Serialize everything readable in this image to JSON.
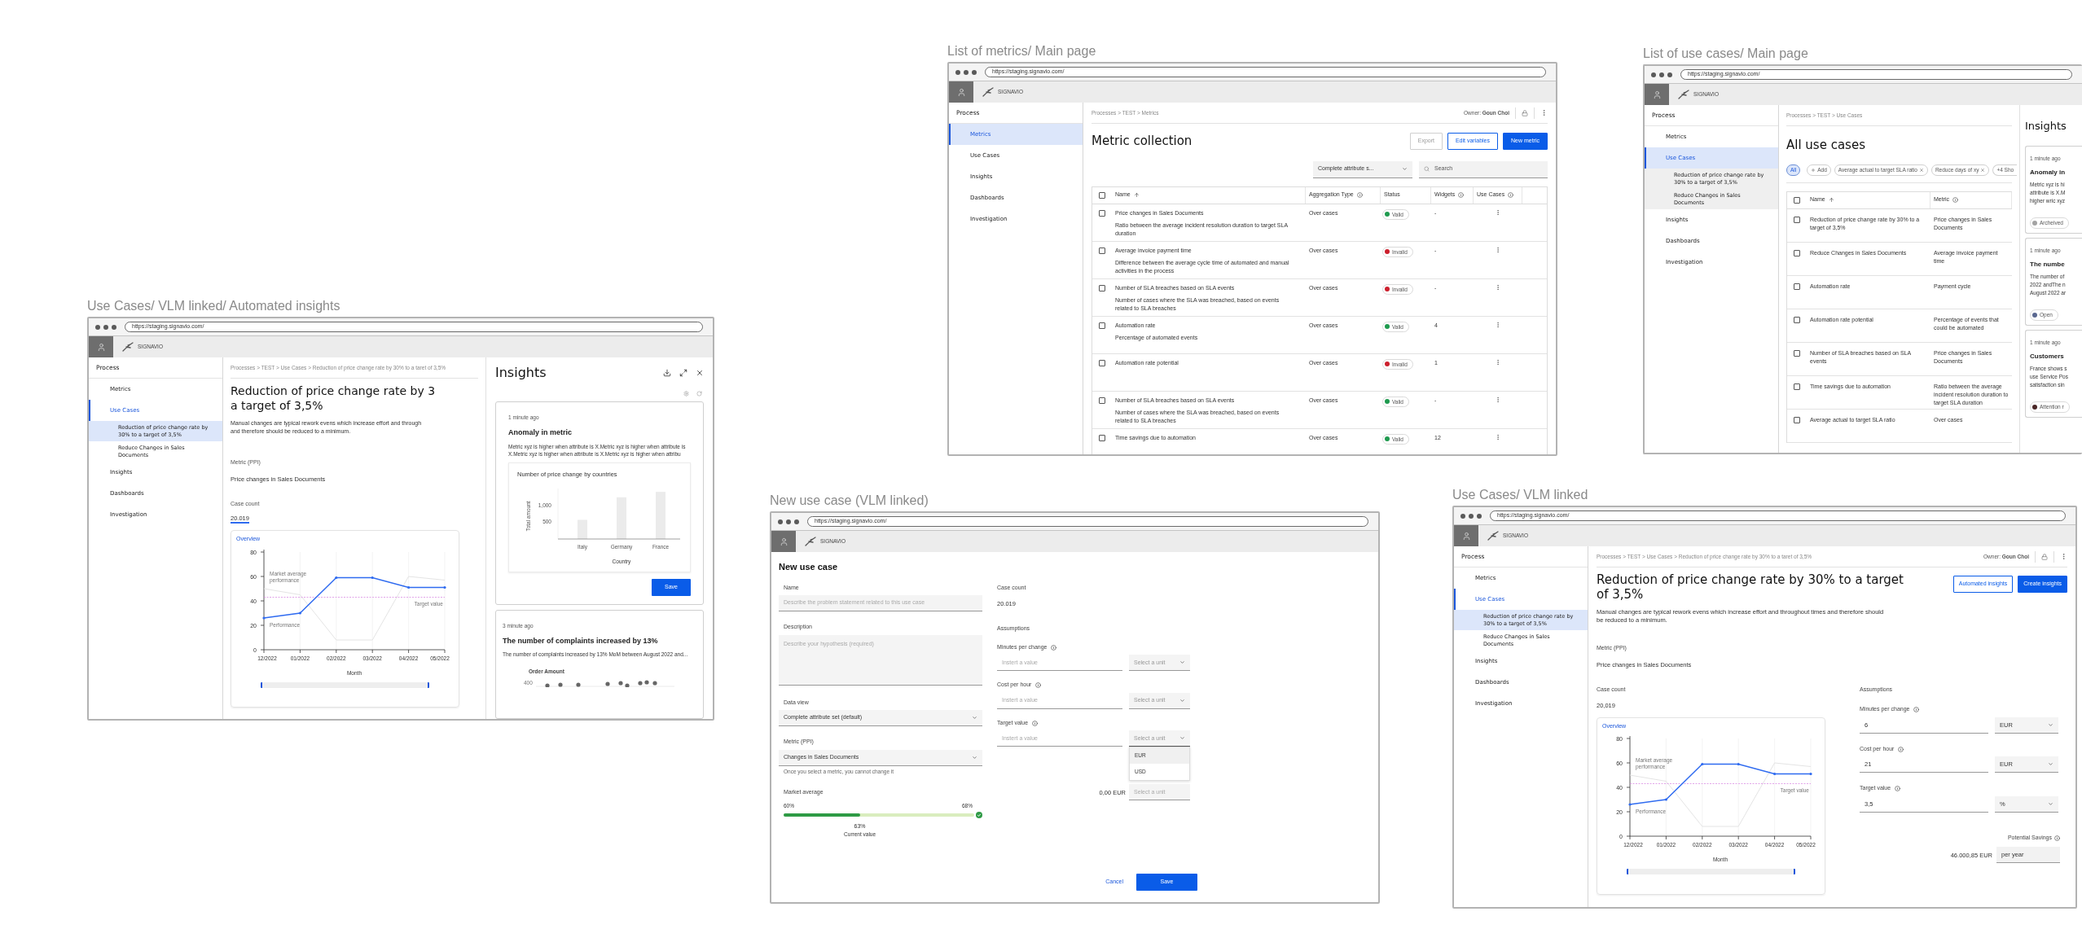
{
  "metrics_frame": {
    "caption": "List of metrics/ Main page",
    "url": "https://staging.signavio.com/",
    "brand": "SIGNAVIO",
    "sidebar": {
      "heading": "Process",
      "items": [
        {
          "label": "Metrics",
          "selected": true
        },
        {
          "label": "Use Cases",
          "selected": false
        },
        {
          "label": "Insights",
          "selected": false
        },
        {
          "label": "Dashboards",
          "selected": false
        },
        {
          "label": "Investigation",
          "selected": false
        }
      ]
    },
    "breadcrumb": "Processes > TEST > Metrics",
    "owner": "Owner: **Goun Choi**",
    "title": "Metric collection",
    "buttons": [
      {
        "label": "Export",
        "kind": "disabled"
      },
      {
        "label": "Edit variables",
        "kind": "outline"
      },
      {
        "label": "New metric",
        "kind": "primary"
      }
    ],
    "data_view": "Complete attribute s...",
    "search": {
      "placeholder": "Search"
    },
    "table": {
      "header_checked": false,
      "columns": [
        {
          "label": "Name",
          "kind": "sortable"
        },
        {
          "label": "Aggregation Type",
          "kind": "info"
        },
        {
          "label": "Status",
          "kind": "plain"
        },
        {
          "label": "Widgets",
          "kind": "info"
        },
        {
          "label": "Use Cases",
          "kind": "info"
        }
      ],
      "rows": [
        {
          "checked": false,
          "name": "Price changes in Sales Documents",
          "description": "Ratio between the average incident resolution duration to target SLA duration",
          "aggregation": "Over cases",
          "status": {
            "label": "Valid",
            "color": "#1f9a4f"
          },
          "widgets": "-"
        },
        {
          "checked": false,
          "name": "Average invoice payment time",
          "description": "Difference between the average cycle time of automated and manual activities in the process",
          "aggregation": "Over cases",
          "status": {
            "label": "Invalid",
            "color": "#cc1f2d"
          },
          "widgets": "-"
        },
        {
          "checked": false,
          "name": "Number of SLA breaches based on SLA events",
          "description": "Number of cases where the SLA was breached, based on events related to SLA breaches",
          "aggregation": "Over cases",
          "status": {
            "label": "Invalid",
            "color": "#cc1f2d"
          },
          "widgets": "-"
        },
        {
          "checked": false,
          "name": "Automation rate",
          "description": "Percentage of automated events",
          "aggregation": "Over cases",
          "status": {
            "label": "Valid",
            "color": "#1f9a4f"
          },
          "widgets": "4"
        },
        {
          "checked": false,
          "name": "Automation rate potential",
          "aggregation": "Over cases",
          "status": {
            "label": "Invalid",
            "color": "#cc1f2d"
          },
          "widgets": "1"
        },
        {
          "checked": false,
          "name": "Number of SLA breaches based on SLA events",
          "description": "Number of cases where the SLA was breached, based on events related to SLA breaches",
          "aggregation": "Over cases",
          "status": {
            "label": "Valid",
            "color": "#1f9a4f"
          },
          "widgets": "-"
        },
        {
          "checked": false,
          "name": "Time savings due to automation",
          "aggregation": "Over cases",
          "status": {
            "label": "Valid",
            "color": "#1f9a4f"
          },
          "widgets": "12"
        }
      ]
    }
  },
  "use_cases_frame": {
    "caption": "List of use cases/ Main page",
    "url": "https://staging.signavio.com/",
    "brand": "SIGNAVIO",
    "sidebar": {
      "heading": "Process",
      "items": [
        {
          "label": "Metrics",
          "selected": false
        },
        {
          "label": "Use Cases",
          "selected": true,
          "children": [
            {
              "label": "Reduction of price change rate by 30% to a target of 3,5%",
              "selected": false
            },
            {
              "label": "Reduce Changes in Sales Documents",
              "selected": false
            }
          ]
        },
        {
          "label": "Insights",
          "selected": false
        },
        {
          "label": "Dashboards",
          "selected": false
        },
        {
          "label": "Investigation",
          "selected": false
        }
      ]
    },
    "breadcrumb": "Processes > TEST > Use Cases",
    "title": "All use cases",
    "filters": [
      {
        "label": "All",
        "kind": "all",
        "selected": true
      },
      {
        "label": "Add",
        "kind": "add",
        "selected": false
      },
      {
        "label": "Average actual to target SLA ratio",
        "kind": "filter",
        "selected": false
      },
      {
        "label": "Reduce days of xy",
        "kind": "filter",
        "selected": false
      },
      {
        "label": "+4 Sho",
        "kind": "more",
        "selected": false
      }
    ],
    "table": {
      "header_checked": false,
      "columns": [
        {
          "label": "Name",
          "kind": "sortable"
        },
        {
          "label": "Metric",
          "kind": "info"
        }
      ],
      "rows": [
        {
          "checked": false,
          "name": "Reduction of price change rate by 30% to a target of 3,5%",
          "metric": "Price changes in Sales Documents"
        },
        {
          "checked": false,
          "name": "Reduce Changes in Sales Documents",
          "metric": "Average invoice payment time"
        },
        {
          "checked": false,
          "name": "Automation rate",
          "metric": "Payment cycle"
        },
        {
          "checked": false,
          "name": "Automation rate potential",
          "metric": "Percentage of events that could be automated"
        },
        {
          "checked": false,
          "name": "Number of SLA breaches based on SLA events",
          "metric": "Price changes in Sales Documents"
        },
        {
          "checked": false,
          "name": "Time savings due to automation",
          "metric": "Ratio between the average incident resolution duration to target SLA duration"
        },
        {
          "checked": false,
          "name": "Average actual to target SLA ratio",
          "metric": "Over cases"
        }
      ]
    },
    "insights": {
      "title": "Insights",
      "cards": [
        {
          "time": "1 minute ago",
          "title": "Anomaly in",
          "lines": [
            "Metric xyz is hi",
            "attribute is X.M",
            "higher wric xyz"
          ],
          "status": {
            "label": "Archeived",
            "color": "#a3a3a3"
          }
        },
        {
          "time": "1 minute ago",
          "title": "The numbe",
          "lines": [
            "The number of",
            "2022 andThe n",
            "August 2022 ar"
          ],
          "status": {
            "label": "Open",
            "color": "#5a6890"
          }
        },
        {
          "time": "1 minute ago",
          "title": "Customers",
          "lines": [
            "France shows s",
            "use Service Pos",
            "satisfaction sin"
          ],
          "status": {
            "label": "Attention r",
            "color": "#4a2626"
          }
        }
      ]
    }
  },
  "insights_frame": {
    "caption": "Use Cases/ VLM linked/ Automated insights",
    "url": "https://staging.signavio.com/",
    "brand": "SIGNAVIO",
    "sidebar": {
      "heading": "Process",
      "items": [
        {
          "label": "Metrics",
          "selected": false
        },
        {
          "label": "Use Cases",
          "selected": true,
          "children": [
            {
              "label": "Reduction of price change rate by 30% to a target of 3,5%",
              "selected": true
            },
            {
              "label": "Reduce Changes in Sales Documents",
              "selected": false
            }
          ]
        },
        {
          "label": "Insights",
          "selected": false
        },
        {
          "label": "Dashboards",
          "selected": false
        },
        {
          "label": "Investigation",
          "selected": false
        }
      ]
    },
    "breadcrumb": "Processes > TEST > Use Cases > Reduction of price change rate by 30% to a taret of 3,5%",
    "title_lines": [
      "Reduction of price change rate by 3",
      "a target of 3,5%"
    ],
    "description_lines": [
      "Manual changes are typical rework evens which increase effort and through",
      "and therefore should be reduced to a minimum."
    ],
    "metric_label": "Metric (PPI)",
    "metric_value": "Price changes in Sales Documents",
    "case_count_label": "Case count",
    "case_count": "20.019",
    "chart": {
      "chart_data": {
        "type": "line",
        "title": "Overview",
        "xlabel": "Month",
        "categories": [
          "12/2022",
          "01/2022",
          "02/2022",
          "03/2022",
          "04/2022",
          "05/2022"
        ],
        "ylim": [
          0,
          80
        ],
        "yticks": [
          0,
          20,
          40,
          60,
          80
        ],
        "series": [
          {
            "name": "Performance",
            "color": "#2f6bf0",
            "values": [
              26,
              30,
              59,
              59,
              51,
              51
            ]
          },
          {
            "name": "Market average performance",
            "color": "#e4e4e4",
            "values": [
              50,
              45,
              8,
              8,
              60,
              57
            ]
          },
          {
            "name": "Target value",
            "color": "#d98be3",
            "values": [
              43,
              43,
              43,
              43,
              43,
              43
            ],
            "line_style": "dashed"
          }
        ],
        "grid": true
      }
    },
    "panel": {
      "title": "Insights",
      "cards": [
        {
          "time": "1 minute ago",
          "title": "Anomaly in metric",
          "text": "Metric xyz is higher when attribute is X.Metric xyz is higher when attribute is X.Metric xyz is higher when attribute is X.Metric xyz is higher when attribu",
          "chart_data": {
            "type": "bar",
            "title": "Number of price change by countries",
            "xlabel": "Country",
            "ylabel": "Total amount",
            "categories": [
              "Italy",
              "Germany",
              "France"
            ],
            "values": [
              570,
              1240,
              1400
            ],
            "ylim": [
              0,
              1500
            ],
            "yticks": [
              {
                "value": 500,
                "label": "500"
              },
              {
                "value": 1000,
                "label": "1,000"
              }
            ]
          },
          "button": "Save"
        },
        {
          "time": "3 minute ago",
          "title": "The number of complaints increased by 13%",
          "text": "The number of complaints increased by 13% MoM between August 2022 and...",
          "chart_title": "Order Amount",
          "tick": "400"
        }
      ]
    }
  },
  "new_use_case_frame": {
    "caption": "New use case (VLM linked)",
    "url": "https://staging.signavio.com/",
    "brand": "SIGNAVIO",
    "heading": "New use case",
    "name": {
      "label": "Name",
      "placeholder": "Describe the problem statement related to this use case"
    },
    "description": {
      "label": "Description",
      "placeholder": "Describe your hypothesis (required)"
    },
    "data_view": {
      "label": "Data view",
      "value": "Complete attribute set (default)"
    },
    "metric": {
      "label": "Metric (PPI)",
      "value": "Changes in Sales Documents",
      "hint": "Once you select a metric, you cannot change it"
    },
    "market_average": {
      "label": "Market average",
      "min": "60%",
      "max": "68%",
      "level": 0.4,
      "value": "63%",
      "caption": "Current value"
    },
    "case_count": {
      "label": "Case count",
      "value": "20.019"
    },
    "assumptions_label": "Assumptions",
    "assumptions": [
      {
        "label": "Minutes per change",
        "placeholder": "Instert a value",
        "unit_placeholder": "Select a unit",
        "expanded": false
      },
      {
        "label": "Cost per hour",
        "placeholder": "Instert a value",
        "unit_placeholder": "Select a unit",
        "expanded": false
      },
      {
        "label": "Target value",
        "placeholder": "Instert a value",
        "unit_placeholder": "Select a unit",
        "expanded": true,
        "options": [
          {
            "label": "EUR",
            "selected": true
          },
          {
            "label": "USD",
            "selected": false
          }
        ]
      }
    ],
    "total": {
      "value": "0,00 EUR",
      "unit_placeholder": "Select a unit"
    },
    "cancel": "Cancel",
    "save": "Save"
  },
  "vlm_linked_frame": {
    "caption": "Use Cases/ VLM linked",
    "url": "https://staging.signavio.com/",
    "brand": "SIGNAVIO",
    "sidebar": {
      "heading": "Process",
      "items": [
        {
          "label": "Metrics",
          "selected": false
        },
        {
          "label": "Use Cases",
          "selected": true,
          "children": [
            {
              "label": "Reduction of price change rate by 30% to a target of 3,5%",
              "selected": true
            },
            {
              "label": "Reduce Changes in Sales Documents",
              "selected": false
            }
          ]
        },
        {
          "label": "Insights",
          "selected": false
        },
        {
          "label": "Dashboards",
          "selected": false
        },
        {
          "label": "Investigation",
          "selected": false
        }
      ]
    },
    "breadcrumb": "Processes > TEST > Use Cases > Reduction of price change rate by 30% to a taret of 3,5%",
    "owner": "Owner: **Goun Choi**",
    "title": "Reduction of price change rate by 30% to a target of 3,5%",
    "buttons": [
      {
        "label": "Automated insights",
        "kind": "outline"
      },
      {
        "label": "Create insights",
        "kind": "primary"
      }
    ],
    "description": "Manual changes are typical rework evens which increase effort and throughout times and therefore should be reduced to a minimum.",
    "metric_label": "Metric (PPI)",
    "metric_value": "Price changes in Sales Documents",
    "case_count_label": "Case count",
    "case_count": "20,019",
    "chart": {
      "chart_data": {
        "type": "line",
        "title": "Overview",
        "xlabel": "Month",
        "categories": [
          "12/2022",
          "01/2022",
          "02/2022",
          "03/2022",
          "04/2022",
          "05/2022"
        ],
        "ylim": [
          0,
          80
        ],
        "yticks": [
          0,
          20,
          40,
          60,
          80
        ],
        "series": [
          {
            "name": "Performance",
            "color": "#2f6bf0",
            "values": [
              26,
              30,
              59,
              59,
              51,
              51
            ]
          },
          {
            "name": "Market average performance",
            "color": "#e4e4e4",
            "values": [
              50,
              45,
              8,
              8,
              60,
              57
            ]
          },
          {
            "name": "Target value",
            "color": "#d98be3",
            "values": [
              43,
              43,
              43,
              43,
              43,
              43
            ],
            "line_style": "dashed"
          }
        ],
        "grid": true
      }
    },
    "assumptions_label": "Assumptions",
    "assumptions": [
      {
        "label": "Minutes per change",
        "value": "6",
        "unit": "EUR"
      },
      {
        "label": "Cost per hour",
        "value": "21",
        "unit": "EUR"
      },
      {
        "label": "Target value",
        "value": "3,5",
        "unit": "%"
      }
    ],
    "savings": {
      "label": "Potential Savings",
      "value": "46.000,85 EUR",
      "period": "per year"
    }
  }
}
